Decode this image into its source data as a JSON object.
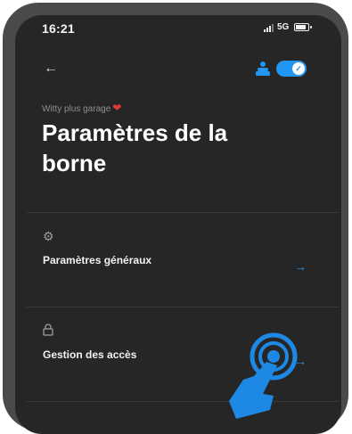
{
  "status": {
    "time": "16:21",
    "network": "5G"
  },
  "header": {
    "back_icon": "back-arrow-icon",
    "charger_icon": "charger-user-icon",
    "toggle_on": true
  },
  "station": {
    "name": "Witty plus garage",
    "title": "Paramètres de la borne"
  },
  "menu": [
    {
      "icon": "gear-icon",
      "label": "Paramètres généraux"
    },
    {
      "icon": "lock-icon",
      "label": "Gestion des accès"
    }
  ],
  "colors": {
    "accent": "#2196f3",
    "background": "#262626",
    "text": "#ffffff",
    "heart": "#e53935"
  }
}
